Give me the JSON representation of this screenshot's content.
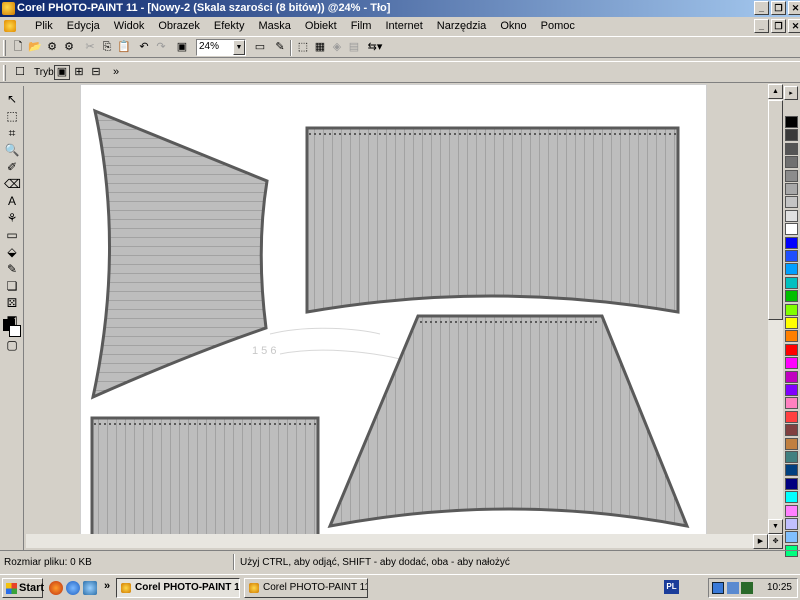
{
  "window": {
    "title": "Corel PHOTO-PAINT 11 - [Nowy-2 (Skala szarości (8 bitów)) @24% - Tło]"
  },
  "menu": {
    "items": [
      {
        "label": "Plik"
      },
      {
        "label": "Edycja"
      },
      {
        "label": "Widok"
      },
      {
        "label": "Obrazek"
      },
      {
        "label": "Efekty"
      },
      {
        "label": "Maska"
      },
      {
        "label": "Obiekt"
      },
      {
        "label": "Film"
      },
      {
        "label": "Internet"
      },
      {
        "label": "Narzędzia"
      },
      {
        "label": "Okno"
      },
      {
        "label": "Pomoc"
      }
    ]
  },
  "toolbar": {
    "zoom_value": "24%",
    "mode_label": "Tryb"
  },
  "statusbar": {
    "file_size": "Rozmiar pliku: 0 KB",
    "hint": "Użyj CTRL, aby odjąć, SHIFT - aby dodać, oba - aby nałożyć"
  },
  "taskbar": {
    "start_label": "Start",
    "tasks": [
      {
        "label": "Corel PHOTO-PAINT 1..."
      },
      {
        "label": "Corel PHOTO-PAINT 11"
      }
    ],
    "overflow": "»",
    "language": "PL",
    "clock": "10:25"
  },
  "canvas": {
    "fill_color": "#bdbdbd",
    "outline_color": "#5a5a5a",
    "stripe_color": "#6e6e6e"
  },
  "palette": {
    "colors": [
      "#000000",
      "#3a3a3a",
      "#555555",
      "#707070",
      "#8c8c8c",
      "#a8a8a8",
      "#c4c4c4",
      "#e0e0e0",
      "#ffffff",
      "#0000ff",
      "#1f4fff",
      "#00a0ff",
      "#00c0c0",
      "#00c000",
      "#80ff00",
      "#ffff00",
      "#ff8000",
      "#ff0000",
      "#ff00ff",
      "#c000c0",
      "#8000ff",
      "#ff80c0",
      "#ff4040",
      "#804040",
      "#c08040",
      "#408080",
      "#004080",
      "#000080",
      "#00ffff",
      "#ff80ff",
      "#c0c0ff",
      "#80c0ff",
      "#00ff80"
    ]
  }
}
